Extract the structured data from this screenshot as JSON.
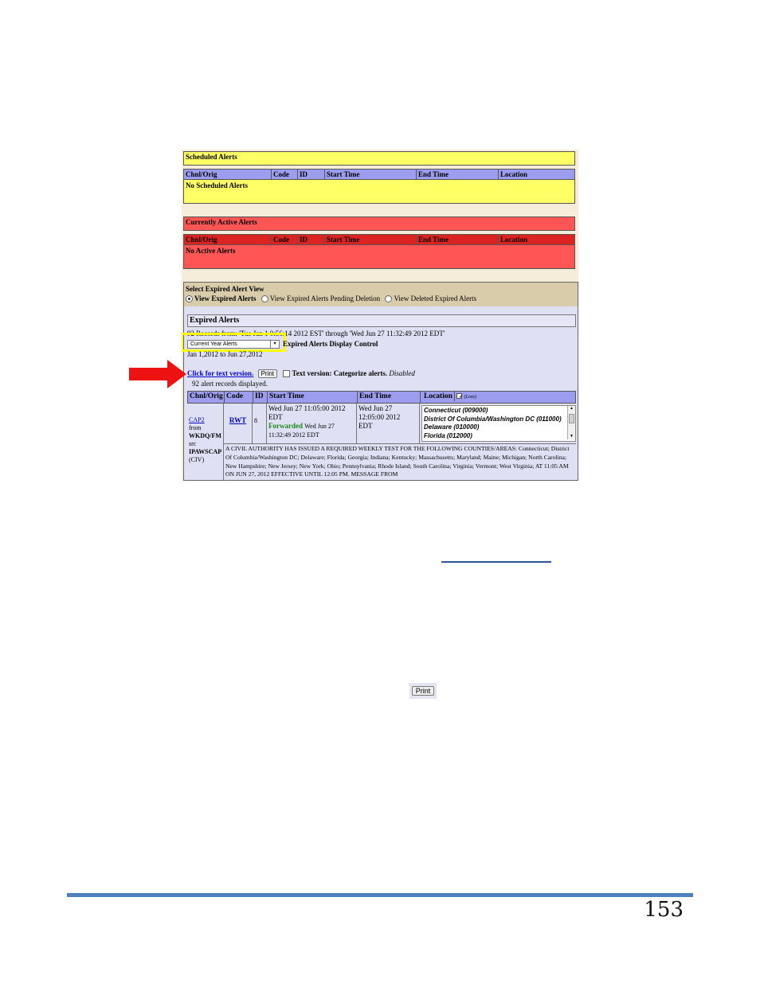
{
  "scheduled": {
    "title": "Scheduled Alerts",
    "columns": [
      "Chnl/Orig",
      "Code",
      "ID",
      "Start Time",
      "End Time",
      "Location"
    ],
    "empty": "No Scheduled Alerts"
  },
  "active": {
    "title": "Currently Active Alerts",
    "columns": [
      "Chnl/Orig",
      "Code",
      "ID",
      "Start Time",
      "End Time",
      "Location"
    ],
    "empty": "No Active Alerts"
  },
  "view_select": {
    "label": "Select Expired Alert View",
    "options": [
      "View Expired Alerts",
      "View Expired Alerts Pending Deletion",
      "View Deleted Expired Alerts"
    ],
    "selected": 0
  },
  "expired": {
    "title": "Expired Alerts",
    "records_line": "92 Records from: 'Tue Jan 1 0:56:14 2012 EST' through 'Wed Jun 27 11:32:49 2012 EDT'",
    "dropdown_value": "Current Year Alerts",
    "display_control": "Expired Alerts Display Control",
    "date_range": "Jan 1,2012 to Jun 27,2012",
    "text_link": "Click for text version.",
    "print_label": "Print",
    "text_version_label": "Text version: Categorize alerts.",
    "disabled_label": "Disabled",
    "displayed": "92 alert records displayed.",
    "columns": [
      "Chnl/Orig",
      "Code",
      "ID",
      "Start Time",
      "End Time",
      "Location"
    ],
    "location_toggle": "(Lists)",
    "row": {
      "chnl_link": "CAP2",
      "chnl_lines": [
        "from",
        "WKDQ/FM",
        "src",
        "IPAWSCAP",
        "(CIV)"
      ],
      "code": "RWT",
      "id": "8",
      "start": [
        "Wed Jun 27 11:05:00 2012",
        "EDT"
      ],
      "forwarded_label": "Forwarded",
      "forwarded_time": "Wed Jun 27",
      "forwarded_time2": "11:32:49 2012 EDT",
      "end": [
        "Wed Jun 27",
        "12:05:00 2012",
        "EDT"
      ],
      "locations": [
        "Connecticut (009000)",
        "District Of Columbia/Washington DC (011000)",
        "Delaware (010000)",
        "Florida (012000)"
      ],
      "message": "A CIVIL AUTHORITY HAS ISSUED A REQUIRED WEEKLY TEST FOR THE FOLLOWING COUNTIES/AREAS: Connecticut; District Of Columbia/Washington DC; Delaware; Florida; Georgia; Indiana; Kentucky; Massachusetts; Maryland; Maine; Michigan; North Carolina; New Hampshire; New Jersey; New York; Ohio; Pennsylvania; Rhode Island; South Carolina; Virginia; Vermont; West Virginia; AT 11:05 AM ON JUN 27, 2012 EFFECTIVE UNTIL 12:05 PM. MESSAGE FROM"
    }
  },
  "standalone_print": "Print",
  "page_number": "153",
  "colors": {
    "rule": "#4f81bd",
    "highlight": "#ffff00",
    "arrow": "#ee1111"
  }
}
